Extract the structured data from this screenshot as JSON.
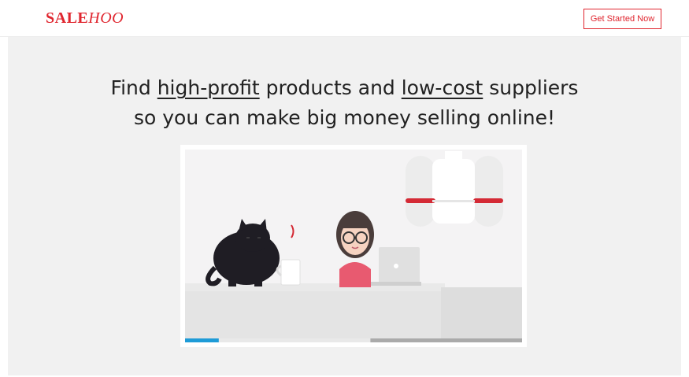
{
  "header": {
    "logo_part1": "SALE",
    "logo_part2": "HOO",
    "cta_label": "Get Started Now"
  },
  "hero": {
    "line1_a": "Find ",
    "line1_b": "high-profit",
    "line1_c": " products and ",
    "line1_d": "low-cost",
    "line1_e": " suppliers",
    "line2": "so you can make big money selling online!"
  },
  "video": {
    "progress": 0.1,
    "buffered": 0.55
  },
  "colors": {
    "brand": "#e0262f",
    "progress": "#1e9bd7"
  }
}
